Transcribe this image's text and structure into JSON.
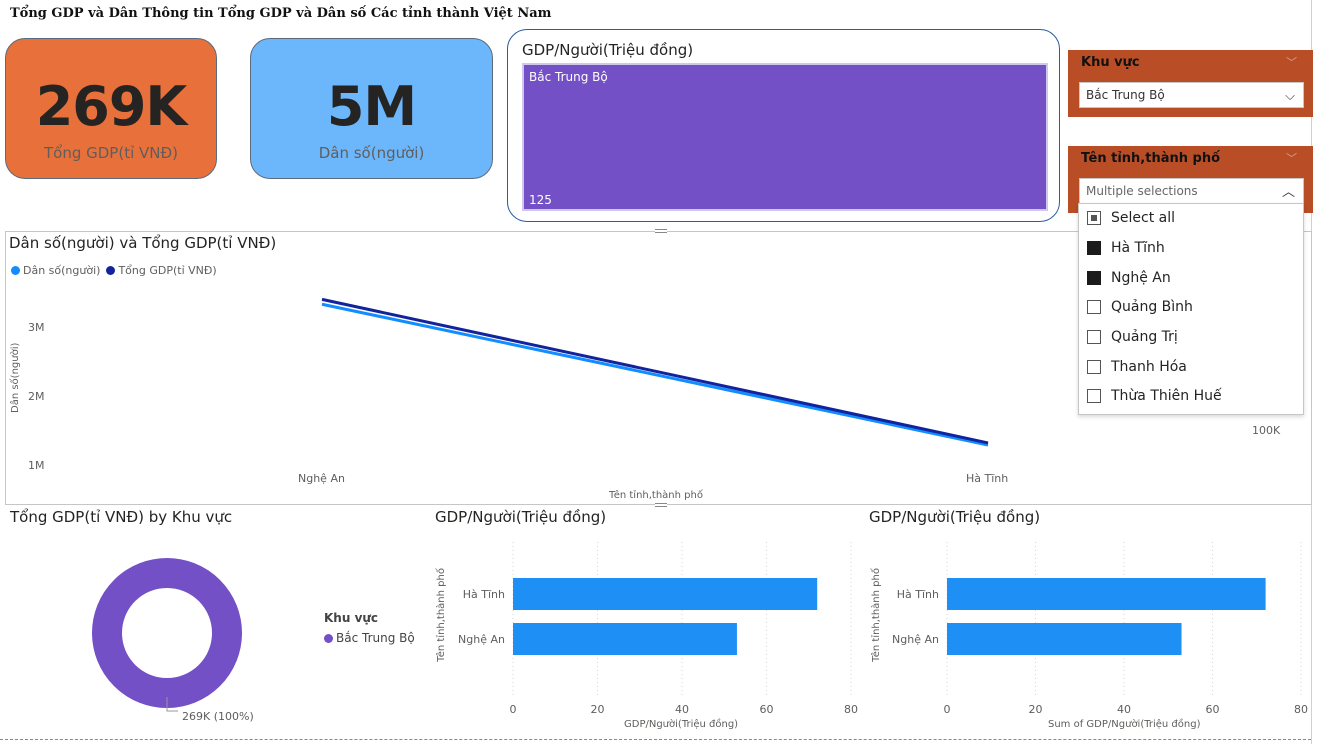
{
  "report": {
    "title": "Tổng GDP và Dân Thông tin Tổng GDP và Dân số Các tỉnh thành Việt Nam"
  },
  "kpis": {
    "gdp": {
      "value": "269K",
      "label": "Tổng GDP(tỉ VNĐ)",
      "color": "#e8703a"
    },
    "population": {
      "value": "5M",
      "label": "Dân số(người)",
      "color": "#6cb6fb"
    }
  },
  "treemap": {
    "title": "GDP/Người(Triệu đồng)",
    "region": "Bắc Trung Bộ",
    "value": "125",
    "color": "#7450c6"
  },
  "slicer_region": {
    "title": "Khu vực",
    "selected": "Bắc Trung Bộ"
  },
  "slicer_province": {
    "title": "Tên tỉnh,thành phố",
    "selected": "Multiple selections",
    "items": [
      {
        "label": "Select all",
        "state": "partial"
      },
      {
        "label": "Hà Tĩnh",
        "state": "checked"
      },
      {
        "label": "Nghệ An",
        "state": "checked"
      },
      {
        "label": "Quảng Bình",
        "state": "unchecked"
      },
      {
        "label": "Quảng Trị",
        "state": "unchecked"
      },
      {
        "label": "Thanh Hóa",
        "state": "unchecked"
      },
      {
        "label": "Thừa Thiên Huế",
        "state": "unchecked"
      }
    ]
  },
  "line_chart": {
    "title": "Dân số(người) và Tổng GDP(tỉ VNĐ)",
    "legend": [
      {
        "name": "Dân số(người)",
        "color": "#118dff"
      },
      {
        "name": "Tổng GDP(tỉ VNĐ)",
        "color": "#12239e"
      }
    ],
    "ylabel": "Dân số(người)",
    "xlabel": "Tên tỉnh,thành phố",
    "yticks": [
      "3M",
      "2M",
      "1M"
    ],
    "right_tick": "100K"
  },
  "donut": {
    "title": "Tổng GDP(tỉ VNĐ) by Khu vực",
    "legend_title": "Khu vực",
    "legend_item": "Bắc Trung Bộ",
    "data_label": "269K (100%)",
    "color": "#7450c6"
  },
  "bar1": {
    "title": "GDP/Người(Triệu đồng)",
    "xlabel": "GDP/Người(Triệu đồng)",
    "ylabel": "Tên tỉnh,thành phố",
    "xticks": [
      "0",
      "20",
      "40",
      "60",
      "80"
    ],
    "categories": [
      "Hà Tĩnh",
      "Nghệ An"
    ]
  },
  "bar2": {
    "title": "GDP/Người(Triệu đồng)",
    "xlabel": "Sum of GDP/Người(Triệu đồng)",
    "ylabel": "Tên tỉnh,thành phố",
    "xticks": [
      "0",
      "20",
      "40",
      "60",
      "80"
    ],
    "categories": [
      "Hà Tĩnh",
      "Nghệ An"
    ]
  },
  "chart_data": [
    {
      "type": "line",
      "title": "Dân số(người) và Tổng GDP(tỉ VNĐ)",
      "xlabel": "Tên tỉnh,thành phố",
      "ylabel": "Dân số(người)",
      "categories": [
        "Nghệ An",
        "Hà Tĩnh"
      ],
      "ylim": [
        1000000,
        3500000
      ],
      "series": [
        {
          "name": "Dân số(người)",
          "values": [
            3330000,
            1290000
          ]
        },
        {
          "name": "Tổng GDP(tỉ VNĐ)",
          "values": [
            3400000,
            1320000
          ]
        }
      ],
      "legend": "top-left"
    },
    {
      "type": "pie",
      "title": "Tổng GDP(tỉ VNĐ) by Khu vực",
      "categories": [
        "Bắc Trung Bộ"
      ],
      "values": [
        269000
      ],
      "legend": "right"
    },
    {
      "type": "bar",
      "title": "GDP/Người(Triệu đồng)",
      "xlabel": "GDP/Người(Triệu đồng)",
      "ylabel": "Tên tỉnh,thành phố",
      "categories": [
        "Hà Tĩnh",
        "Nghệ An"
      ],
      "values": [
        72,
        53
      ],
      "xlim": [
        0,
        80
      ]
    },
    {
      "type": "bar",
      "title": "GDP/Người(Triệu đồng)",
      "xlabel": "Sum of GDP/Người(Triệu đồng)",
      "ylabel": "Tên tỉnh,thành phố",
      "categories": [
        "Hà Tĩnh",
        "Nghệ An"
      ],
      "values": [
        72,
        53
      ],
      "xlim": [
        0,
        80
      ]
    }
  ]
}
